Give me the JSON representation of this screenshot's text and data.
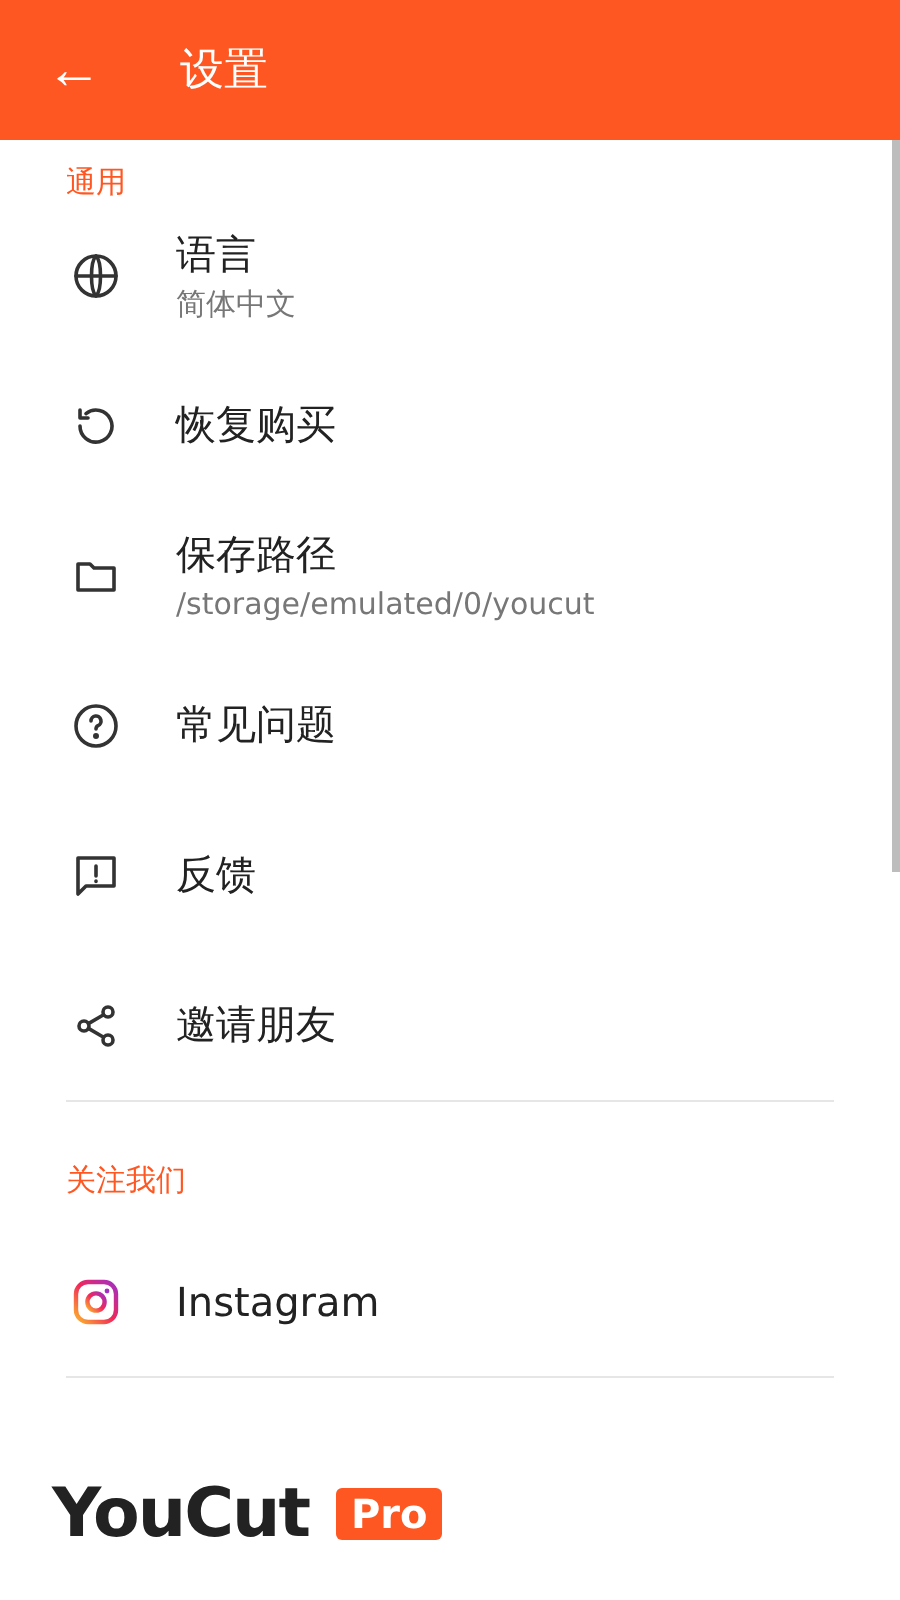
{
  "app_bar": {
    "back": "←",
    "title": "设置"
  },
  "sections": [
    {
      "header": "通用",
      "items": [
        {
          "title": "语言",
          "subtitle": "简体中文"
        },
        {
          "title": "恢复购买"
        },
        {
          "title": "保存路径",
          "subtitle": "/storage/emulated/0/youcut"
        },
        {
          "title": "常见问题"
        },
        {
          "title": "反馈"
        },
        {
          "title": "邀请朋友"
        }
      ]
    },
    {
      "header": "关注我们",
      "items": [
        {
          "title": "Instagram"
        }
      ]
    }
  ],
  "logo": {
    "name": "YouCut",
    "badge": "Pro"
  }
}
